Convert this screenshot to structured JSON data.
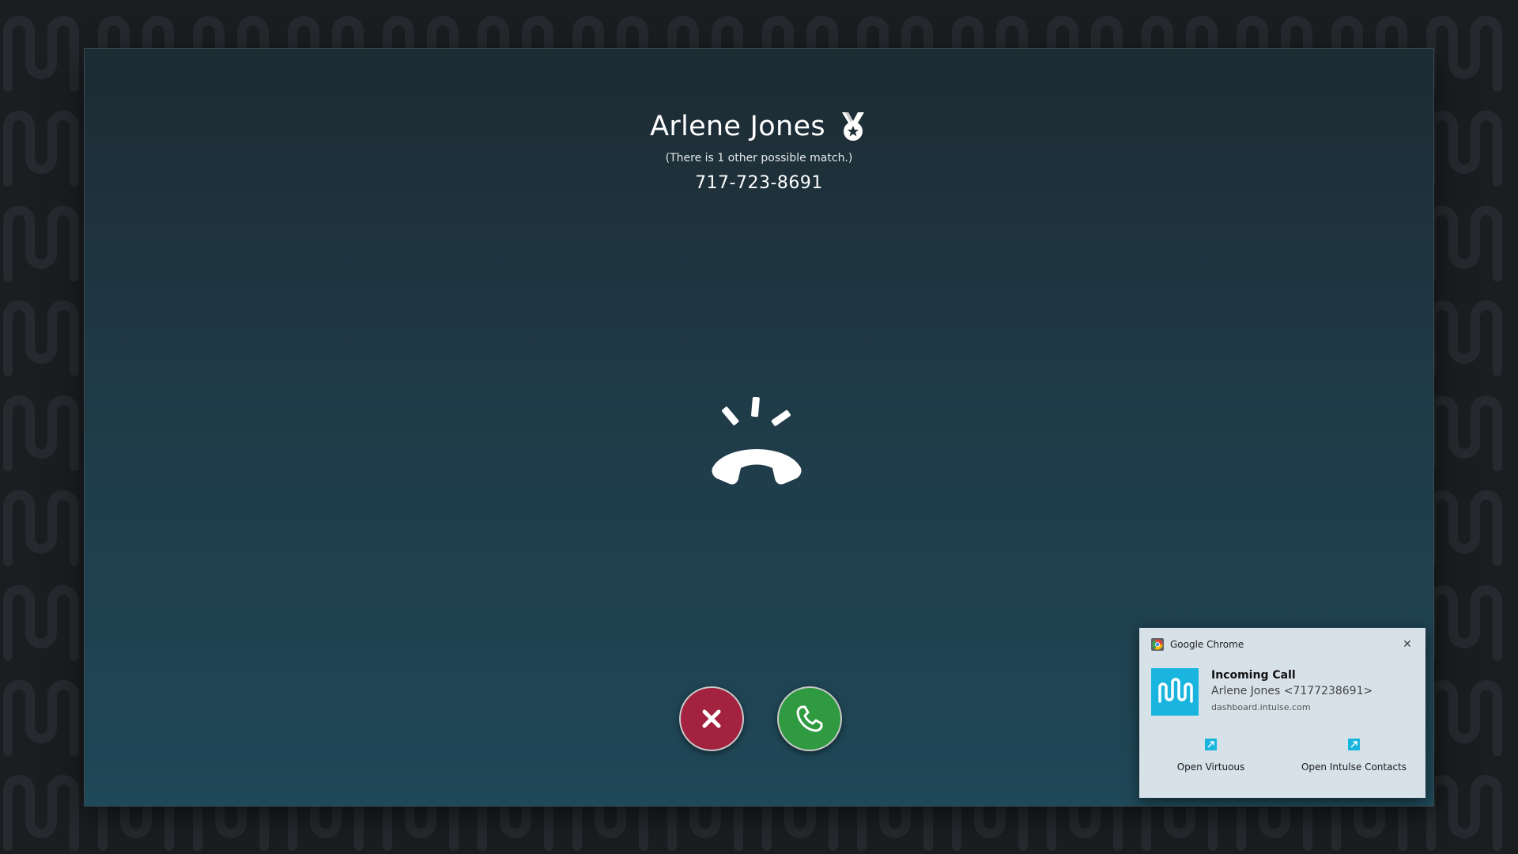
{
  "colors": {
    "accent": "#1ab5df",
    "decline": "#a32240",
    "answer": "#2f9a40",
    "toast_bg": "#d6e1e8"
  },
  "caller": {
    "name": "Arlene Jones",
    "match_note": "(There is 1 other possible match.)",
    "phone": "717-723-8691",
    "badge_icon": "medal-star-icon"
  },
  "status_icon": "ringing-phone-icon",
  "buttons": {
    "decline_icon": "close-icon",
    "answer_icon": "phone-icon"
  },
  "toast": {
    "app_name": "Google Chrome",
    "close_glyph": "✕",
    "title": "Incoming Call",
    "subtitle": "Arlene Jones <7177238691>",
    "domain": "dashboard.intulse.com",
    "actions": [
      {
        "label": "Open Virtuous",
        "icon": "external-link-icon"
      },
      {
        "label": "Open Intulse Contacts",
        "icon": "external-link-icon"
      }
    ]
  }
}
